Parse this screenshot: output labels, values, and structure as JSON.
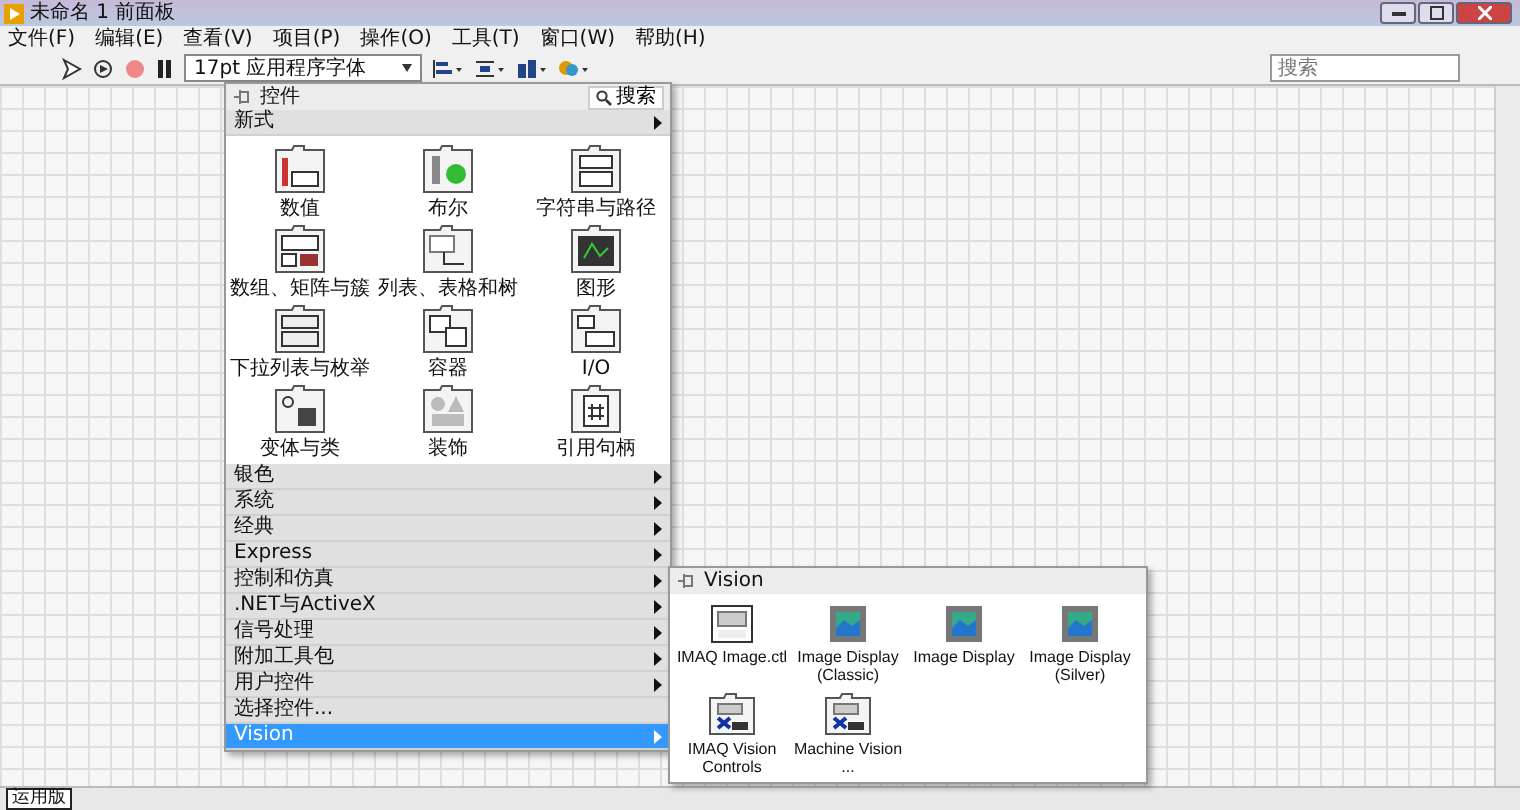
{
  "window": {
    "title": "未命名 1 前面板"
  },
  "menu": [
    "文件(F)",
    "编辑(E)",
    "查看(V)",
    "项目(P)",
    "操作(O)",
    "工具(T)",
    "窗口(W)",
    "帮助(H)"
  ],
  "toolbar": {
    "font": "17pt 应用程序字体",
    "search_placeholder": "搜索"
  },
  "palette": {
    "title": "控件",
    "search": "搜索",
    "section": "新式",
    "items": [
      "数值",
      "布尔",
      "字符串与路径",
      "数组、矩阵与簇",
      "列表、表格和树",
      "图形",
      "下拉列表与枚举",
      "容器",
      "I/O",
      "变体与类",
      "装饰",
      "引用句柄"
    ],
    "categories": [
      {
        "label": "银色",
        "kind": "submenu",
        "selected": false
      },
      {
        "label": "系统",
        "kind": "submenu",
        "selected": false
      },
      {
        "label": "经典",
        "kind": "submenu",
        "selected": false
      },
      {
        "label": "Express",
        "kind": "submenu",
        "selected": false
      },
      {
        "label": "控制和仿真",
        "kind": "submenu",
        "selected": false
      },
      {
        "label": ".NET与ActiveX",
        "kind": "submenu",
        "selected": false
      },
      {
        "label": "信号处理",
        "kind": "submenu",
        "selected": false
      },
      {
        "label": "附加工具包",
        "kind": "submenu",
        "selected": false
      },
      {
        "label": "用户控件",
        "kind": "submenu",
        "selected": false
      },
      {
        "label": "选择控件...",
        "kind": "action",
        "selected": false
      },
      {
        "label": "Vision",
        "kind": "submenu",
        "selected": true
      }
    ]
  },
  "subpalette": {
    "title": "Vision",
    "items": [
      "IMAQ Image.ctl",
      "Image Display (Classic)",
      "Image Display",
      "Image Display (Silver)",
      "IMAQ Vision Controls",
      "Machine Vision ..."
    ]
  },
  "status_bar": {
    "label": "运用版"
  }
}
